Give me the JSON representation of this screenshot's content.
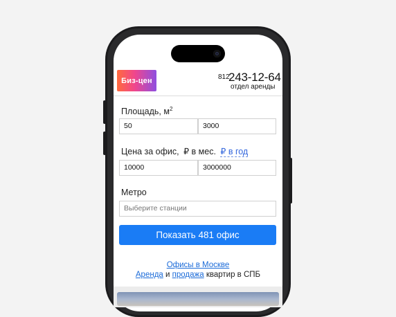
{
  "header": {
    "logo_text": "Биз-цен",
    "phone_prefix": "812",
    "phone_number": "243-12-64",
    "phone_caption": "отдел аренды"
  },
  "area": {
    "label": "Площадь, м",
    "label_sup": "2",
    "from_value": "50",
    "to_value": "3000"
  },
  "price": {
    "label": "Цена за офис,",
    "unit_month": "₽ в мес.",
    "unit_year": "₽ в год",
    "from_value": "10000",
    "to_value": "3000000"
  },
  "metro": {
    "label": "Метро",
    "placeholder": "Выберите станции"
  },
  "submit_label": "Показать 481 офис",
  "footer": {
    "moscow_link": "Офисы в Москве",
    "rent_link": "Аренда",
    "and_text": "и",
    "sale_link": "продажа",
    "tail_text": "квартир в СПБ"
  },
  "colors": {
    "accent": "#1a7cf5",
    "link": "#1a6ad8",
    "logo_gradient": [
      "#ff6a3d",
      "#f0468d",
      "#8e4fe0"
    ]
  }
}
